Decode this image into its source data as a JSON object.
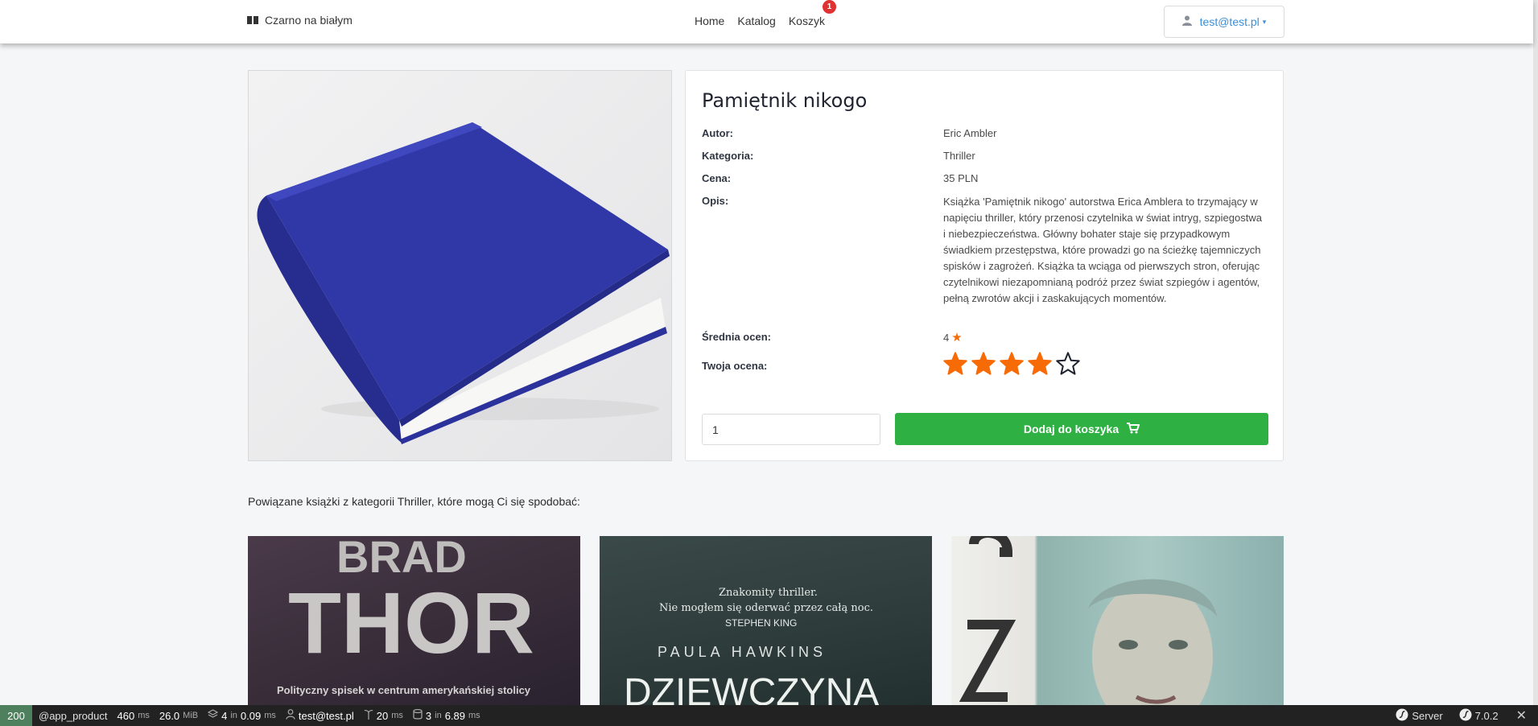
{
  "navbar": {
    "brand": "Czarno na białym",
    "links": [
      "Home",
      "Katalog",
      "Koszyk"
    ],
    "cart_count": "1",
    "user": "test@test.pl"
  },
  "product": {
    "title": "Pamiętnik nikogo",
    "author_label": "Autor:",
    "author": "Eric Ambler",
    "category_label": "Kategoria:",
    "category": "Thriller",
    "price_label": "Cena:",
    "price": "35 PLN",
    "description_label": "Opis:",
    "description": "Książka 'Pamiętnik nikogo' autorstwa Erica Amblera to trzymający w napięciu thriller, który przenosi czytelnika w świat intryg, szpiegostwa i niebezpieczeństwa. Główny bohater staje się przypadkowym świadkiem przestępstwa, które prowadzi go na ścieżkę tajemniczych spisków i zagrożeń. Książka ta wciąga od pierwszych stron, oferując czytelnikowi niezapomnianą podróż przez świat szpiegów i agentów, pełną zwrotów akcji i zaskakujących momentów.",
    "avg_rating_label": "Średnia ocen:",
    "avg_rating": "4",
    "your_rating_label": "Twoja ocena:",
    "your_rating": 4,
    "max_rating": 5,
    "quantity": "1",
    "add_to_cart": "Dodaj do koszyka"
  },
  "related": {
    "heading": "Powiązane książki z kategorii Thriller, które mogą Ci się spodobać:",
    "cards": [
      {
        "lines": [
          "BRAD",
          "THOR",
          "Polityczny spisek w centrum amerykańskiej stolicy"
        ]
      },
      {
        "lines": [
          "Znakomity thriller.",
          "Nie mogłem się oderwać przez całą noc.",
          "STEPHEN KING",
          "PAULA HAWKINS",
          "DZIEWCZYNA"
        ]
      },
      {
        "lines": []
      }
    ]
  },
  "toolbar": {
    "status": "200",
    "route": "@app_product",
    "time": "460",
    "time_unit": "ms",
    "memory": "26.0",
    "memory_unit": "MiB",
    "forms": "4",
    "forms_in": "in",
    "forms_time": "0.09",
    "forms_unit": "ms",
    "user": "test@test.pl",
    "twig": "20",
    "twig_unit": "ms",
    "db": "3",
    "db_in": "in",
    "db_time": "6.89",
    "db_unit": "ms",
    "server": "Server",
    "version": "7.0.2"
  },
  "colors": {
    "accent_green": "#2eb043",
    "star_orange": "#f76b07",
    "link_blue": "#3a8fd8",
    "badge_red": "#e03232",
    "book_blue": "#2f36a8"
  }
}
